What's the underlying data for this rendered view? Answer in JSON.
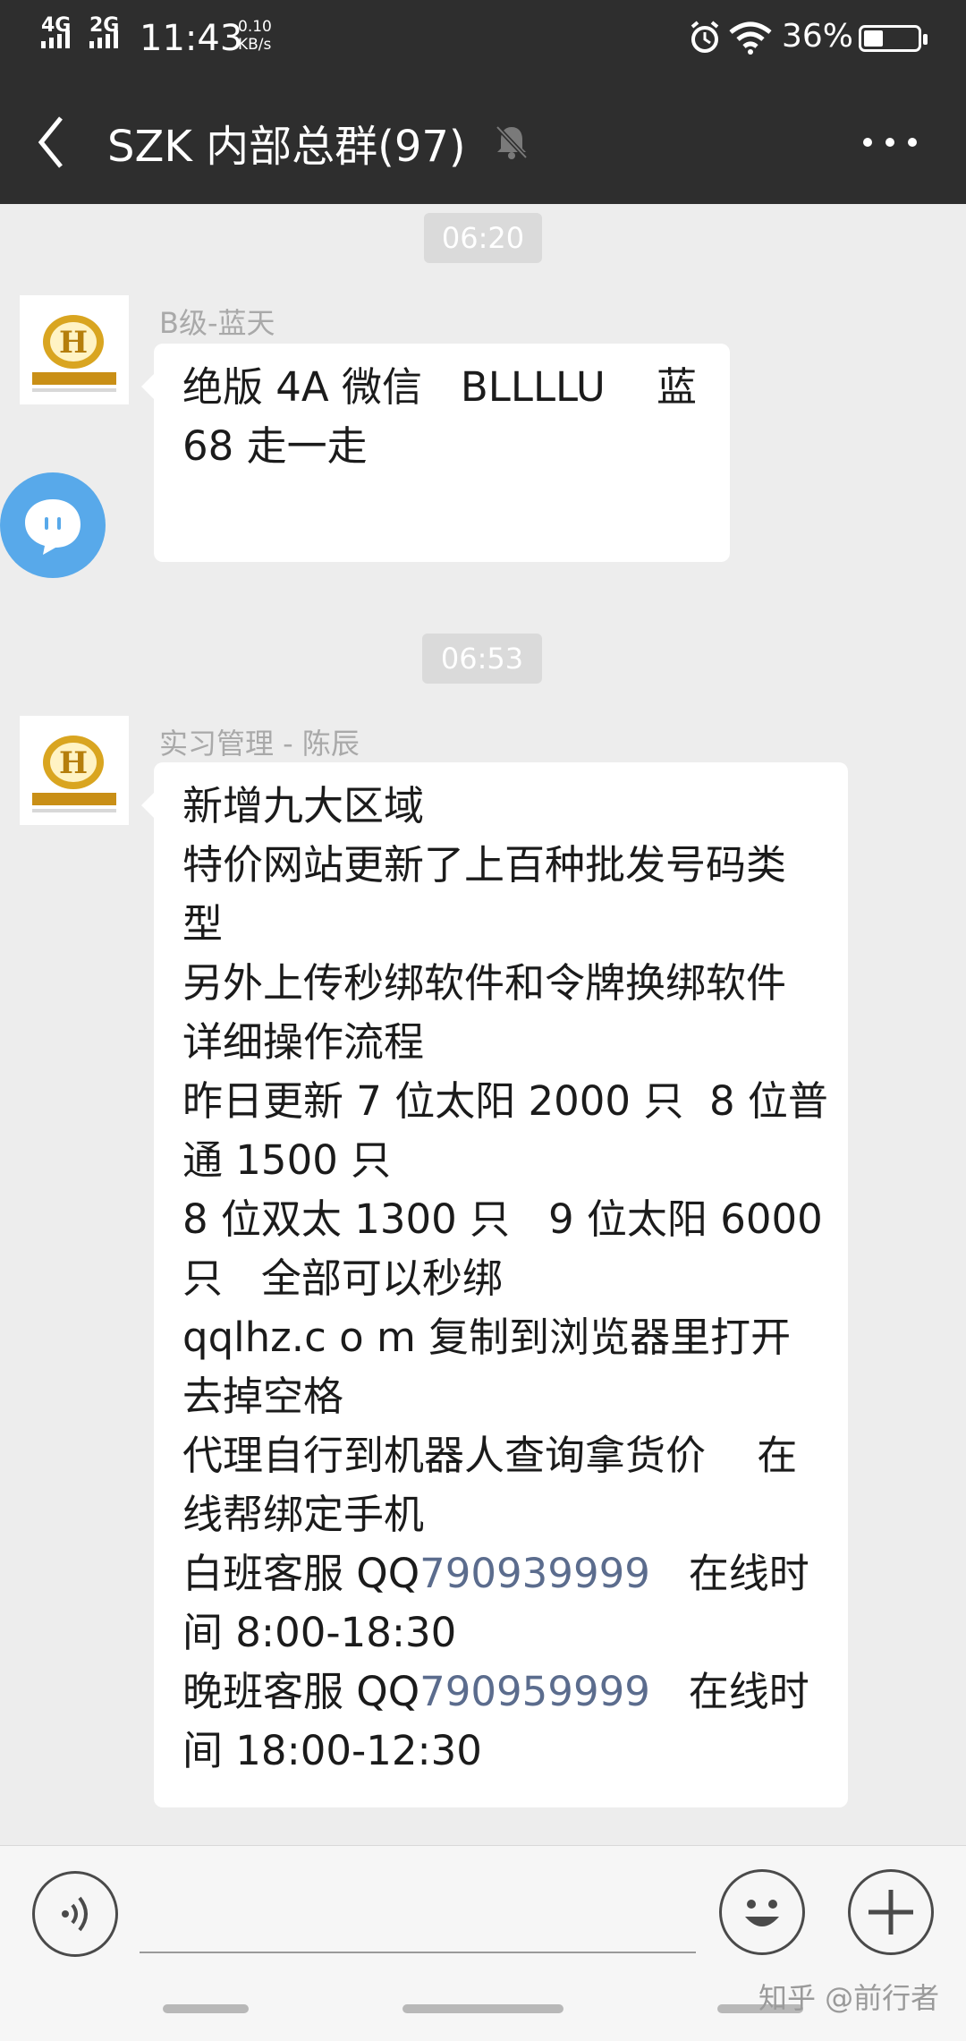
{
  "status_bar": {
    "signal1": "4G",
    "signal2": "2G",
    "time": "11:43",
    "speed_value": "0.10",
    "speed_unit": "KB/s",
    "battery": "36%",
    "battery_level": 0.36
  },
  "header": {
    "title": "SZK 内部总群(97)",
    "back_icon": "chevron-left-icon",
    "mute_icon": "bell-off-icon",
    "more_icon": "more-dots-icon"
  },
  "messages": [
    {
      "timestamp": "06:20",
      "sender": "B级-蓝天",
      "lines": [
        "绝版 4A 微信   BLLLLU    蓝",
        "",
        "68 走一走"
      ]
    },
    {
      "timestamp": "06:53",
      "sender": "实习管理 - 陈辰",
      "lines": [
        "新增九大区域",
        "特价网站更新了上百种批发号码类",
        "型",
        "另外上传秒绑软件和令牌换绑软件",
        "详细操作流程",
        "昨日更新 7 位太阳 2000 只  8 位普",
        "通 1500 只",
        "8 位双太 1300 只   9 位太阳 6000",
        "只   全部可以秒绑",
        "qqlhz.c o m 复制到浏览器里打开",
        "去掉空格",
        "代理自行到机器人查询拿货价    在",
        "线帮绑定手机"
      ],
      "qq_lines": [
        {
          "prefix": "白班客服 QQ",
          "number": "790939999",
          "suffix": "   在线时"
        },
        {
          "prefix": "",
          "number": "",
          "suffix": "间 8:00-18:30"
        },
        {
          "prefix": "晚班客服 QQ",
          "number": "790959999",
          "suffix": "   在线时"
        },
        {
          "prefix": "",
          "number": "",
          "suffix": "间 18:00-12:30"
        }
      ]
    }
  ],
  "input_bar": {
    "voice_icon": "voice-icon",
    "emoji_icon": "emoji-icon",
    "plus_icon": "plus-icon"
  },
  "watermark": "知乎 @前行者",
  "colors": {
    "header_bg": "#2e2e2e",
    "chat_bg": "#ededed",
    "link": "#5b6c8d",
    "float_ball": "#58a9ea"
  }
}
